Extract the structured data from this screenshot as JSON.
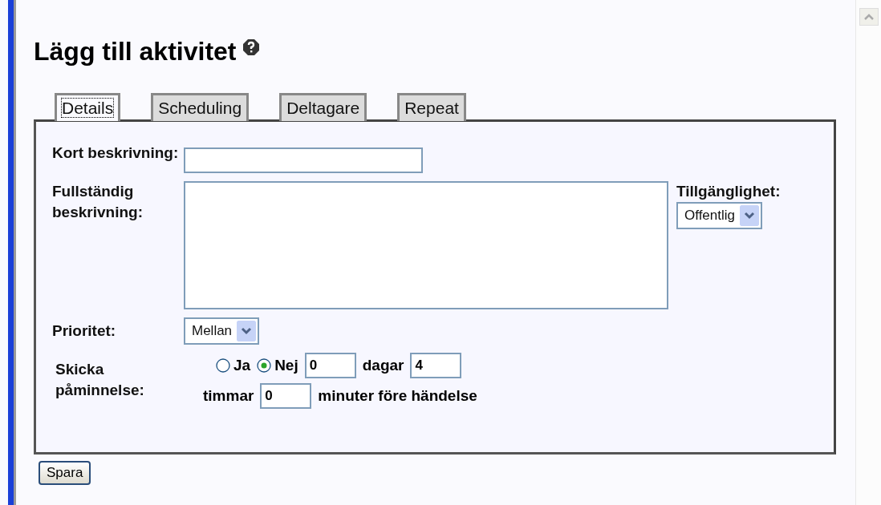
{
  "title": "Lägg till aktivitet",
  "tabs": [
    {
      "label": "Details",
      "selected": true
    },
    {
      "label": "Scheduling",
      "selected": false
    },
    {
      "label": "Deltagare",
      "selected": false
    },
    {
      "label": "Repeat",
      "selected": false
    }
  ],
  "short_description": {
    "label": "Kort beskrivning:"
  },
  "full_description": {
    "label": "Fullständig beskrivning:"
  },
  "availability": {
    "label": "Tillgänglighet:",
    "value": "Offentlig"
  },
  "priority": {
    "label": "Prioritet:",
    "value": "Mellan"
  },
  "reminder": {
    "label": "Skicka påminnelse:",
    "options": [
      {
        "label": "Ja",
        "selected": false
      },
      {
        "label": "Nej",
        "selected": true
      }
    ],
    "days": "0",
    "days_unit": "dagar",
    "hours": "4",
    "hours_unit": "timmar",
    "minutes": "0",
    "minutes_unit": "minuter före händelse"
  },
  "save_button": "Spara"
}
